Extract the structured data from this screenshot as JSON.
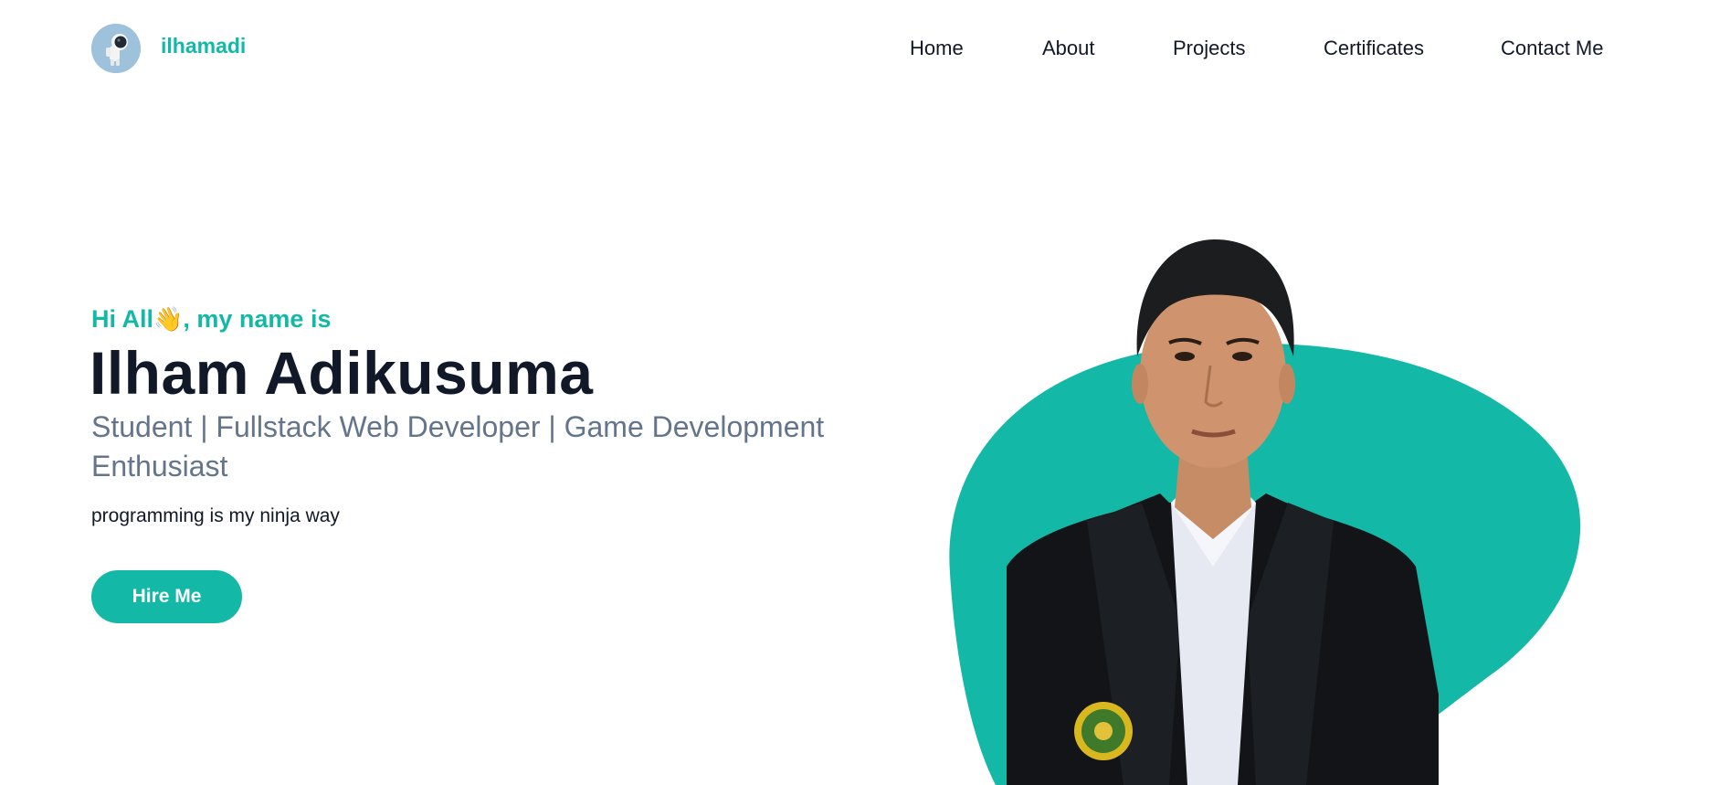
{
  "brand": {
    "name": "ilhamadi",
    "logo_icon": "astronaut-icon"
  },
  "nav": {
    "items": [
      {
        "label": "Home"
      },
      {
        "label": "About"
      },
      {
        "label": "Projects"
      },
      {
        "label": "Certificates"
      },
      {
        "label": "Contact Me"
      }
    ]
  },
  "hero": {
    "greeting_prefix": "Hi All",
    "greeting_emoji": "👋",
    "greeting_suffix": ", my name is",
    "name": "Ilham Adikusuma",
    "subtitle": "Student | Fullstack Web Developer | Game Development Enthusiast",
    "tagline": "programming is my ninja way",
    "cta_label": "Hire Me",
    "photo_icon": "profile-photo"
  },
  "colors": {
    "accent": "#14b8a6",
    "heading": "#111827",
    "muted": "#64748b",
    "logo_bg": "#9fc2dc"
  }
}
